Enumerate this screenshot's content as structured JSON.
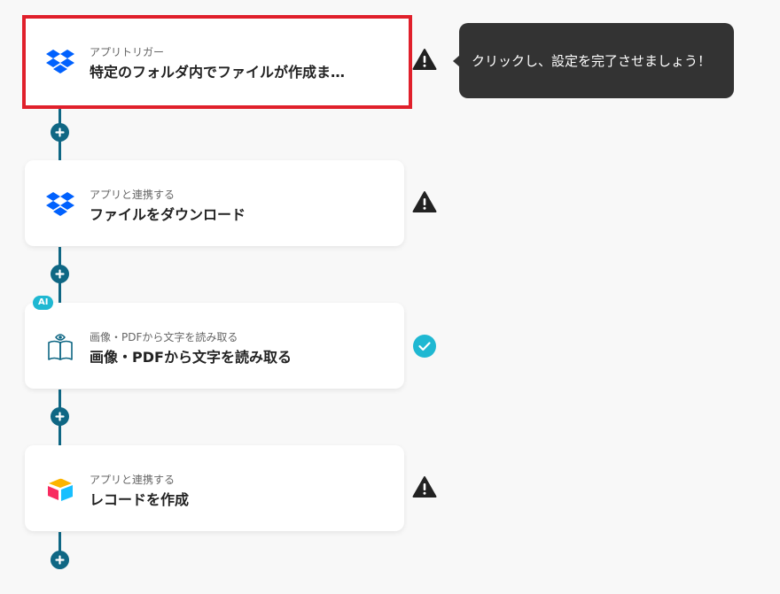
{
  "flow": {
    "steps": [
      {
        "subtitle": "アプリトリガー",
        "title": "特定のフォルダ内でファイルが作成ま…",
        "icon": "dropbox-icon",
        "status": "warning",
        "selected": true
      },
      {
        "subtitle": "アプリと連携する",
        "title": "ファイルをダウンロード",
        "icon": "dropbox-icon",
        "status": "warning",
        "selected": false
      },
      {
        "subtitle": "画像・PDFから文字を読み取る",
        "title": "画像・PDFから文字を読み取る",
        "icon": "ocr-book-icon",
        "status": "complete",
        "badge": "AI",
        "selected": false
      },
      {
        "subtitle": "アプリと連携する",
        "title": "レコードを作成",
        "icon": "airtable-icon",
        "status": "warning",
        "selected": false
      }
    ]
  },
  "tooltip": {
    "text": "クリックし、設定を完了させましょう！"
  },
  "colors": {
    "accent": "#0f6784",
    "selected_border": "#e0202b",
    "complete": "#1fb8d2",
    "warning": "#222222",
    "dropbox": "#0061fe"
  }
}
